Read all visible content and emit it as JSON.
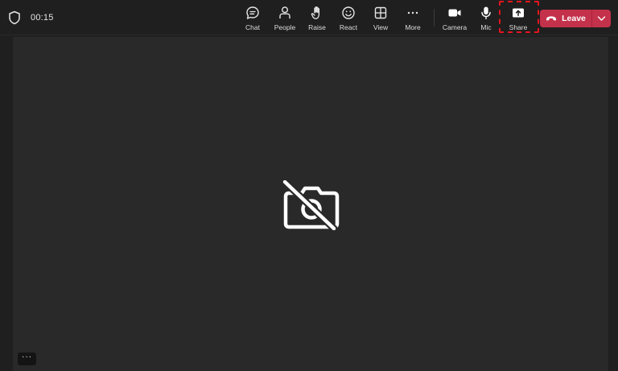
{
  "meeting": {
    "timer": "00:15"
  },
  "toolbar": {
    "chat_label": "Chat",
    "people_label": "People",
    "raise_label": "Raise",
    "react_label": "React",
    "view_label": "View",
    "more_label": "More",
    "camera_label": "Camera",
    "mic_label": "Mic",
    "share_label": "Share"
  },
  "leave": {
    "label": "Leave",
    "color": "#c4314b"
  },
  "stage": {
    "placeholder_icon": "camera-off-icon"
  },
  "overflow": {
    "label": "···"
  },
  "colors": {
    "background": "#1f1f1f",
    "stage": "#292929",
    "highlight": "#e3151f"
  }
}
